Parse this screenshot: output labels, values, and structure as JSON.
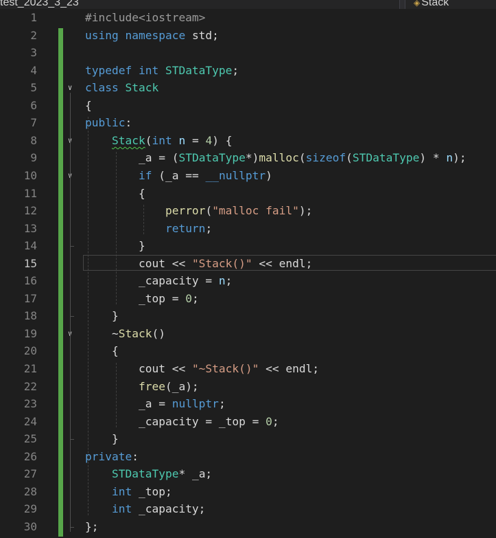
{
  "tabs": {
    "file_tab_label": "test_2023_3_23",
    "member_tab_label": "Stack"
  },
  "editor": {
    "current_line": 15,
    "line_numbers": [
      "1",
      "2",
      "3",
      "4",
      "5",
      "6",
      "7",
      "8",
      "9",
      "10",
      "11",
      "12",
      "13",
      "14",
      "15",
      "16",
      "17",
      "18",
      "19",
      "20",
      "21",
      "22",
      "23",
      "24",
      "25",
      "26",
      "27",
      "28",
      "29",
      "30"
    ],
    "lines": [
      [
        {
          "t": "#include<iostream>",
          "c": "pp"
        }
      ],
      [
        {
          "t": "using namespace ",
          "c": "kw"
        },
        {
          "t": "std;",
          "c": "pl"
        }
      ],
      [],
      [
        {
          "t": "typedef ",
          "c": "kw"
        },
        {
          "t": "int ",
          "c": "kw"
        },
        {
          "t": "STDataType",
          "c": "ty"
        },
        {
          "t": ";",
          "c": "pl"
        }
      ],
      [
        {
          "t": "class ",
          "c": "kw"
        },
        {
          "t": "Stack",
          "c": "ty"
        }
      ],
      [
        {
          "t": "{",
          "c": "pl"
        }
      ],
      [
        {
          "t": "public",
          "c": "kw"
        },
        {
          "t": ":",
          "c": "pl"
        }
      ],
      [
        {
          "t": "    "
        },
        {
          "t": "Stack",
          "c": "ty squig"
        },
        {
          "t": "(",
          "c": "pl"
        },
        {
          "t": "int ",
          "c": "kw"
        },
        {
          "t": "n",
          "c": "par"
        },
        {
          "t": " = ",
          "c": "pl"
        },
        {
          "t": "4",
          "c": "num"
        },
        {
          "t": ") {",
          "c": "pl"
        }
      ],
      [
        {
          "t": "        _a",
          "c": "mem"
        },
        {
          "t": " = (",
          "c": "pl"
        },
        {
          "t": "STDataType",
          "c": "ty"
        },
        {
          "t": "*)",
          "c": "pl"
        },
        {
          "t": "malloc",
          "c": "fn"
        },
        {
          "t": "(",
          "c": "pl"
        },
        {
          "t": "sizeof",
          "c": "kw"
        },
        {
          "t": "(",
          "c": "pl"
        },
        {
          "t": "STDataType",
          "c": "ty"
        },
        {
          "t": ") * ",
          "c": "pl"
        },
        {
          "t": "n",
          "c": "par"
        },
        {
          "t": ");",
          "c": "pl"
        }
      ],
      [
        {
          "t": "        "
        },
        {
          "t": "if ",
          "c": "kw"
        },
        {
          "t": "(_a == ",
          "c": "pl"
        },
        {
          "t": "__nullptr",
          "c": "kw"
        },
        {
          "t": ")",
          "c": "pl"
        }
      ],
      [
        {
          "t": "        {",
          "c": "pl"
        }
      ],
      [
        {
          "t": "            "
        },
        {
          "t": "perror",
          "c": "fn"
        },
        {
          "t": "(",
          "c": "pl"
        },
        {
          "t": "\"malloc fail\"",
          "c": "st"
        },
        {
          "t": ");",
          "c": "pl"
        }
      ],
      [
        {
          "t": "            "
        },
        {
          "t": "return",
          "c": "kw"
        },
        {
          "t": ";",
          "c": "pl"
        }
      ],
      [
        {
          "t": "        }",
          "c": "pl"
        }
      ],
      [
        {
          "t": "        cout << ",
          "c": "pl"
        },
        {
          "t": "\"Stack()\"",
          "c": "st"
        },
        {
          "t": " << endl;",
          "c": "pl"
        }
      ],
      [
        {
          "t": "        _capacity = ",
          "c": "pl"
        },
        {
          "t": "n",
          "c": "par"
        },
        {
          "t": ";",
          "c": "pl"
        }
      ],
      [
        {
          "t": "        _top = ",
          "c": "pl"
        },
        {
          "t": "0",
          "c": "num"
        },
        {
          "t": ";",
          "c": "pl"
        }
      ],
      [
        {
          "t": "    }",
          "c": "pl"
        }
      ],
      [
        {
          "t": "    ",
          "c": "pl"
        },
        {
          "t": "~",
          "c": "pl"
        },
        {
          "t": "Stack",
          "c": "fn"
        },
        {
          "t": "()",
          "c": "pl"
        }
      ],
      [
        {
          "t": "    {",
          "c": "pl"
        }
      ],
      [
        {
          "t": "        cout << ",
          "c": "pl"
        },
        {
          "t": "\"~Stack()\"",
          "c": "st"
        },
        {
          "t": " << endl;",
          "c": "pl"
        }
      ],
      [
        {
          "t": "        "
        },
        {
          "t": "free",
          "c": "fn"
        },
        {
          "t": "(_a);",
          "c": "pl"
        }
      ],
      [
        {
          "t": "        _a = ",
          "c": "pl"
        },
        {
          "t": "nullptr",
          "c": "kw"
        },
        {
          "t": ";",
          "c": "pl"
        }
      ],
      [
        {
          "t": "        _capacity = _top = ",
          "c": "pl"
        },
        {
          "t": "0",
          "c": "num"
        },
        {
          "t": ";",
          "c": "pl"
        }
      ],
      [
        {
          "t": "    }",
          "c": "pl"
        }
      ],
      [
        {
          "t": "private",
          "c": "kw"
        },
        {
          "t": ":",
          "c": "pl"
        }
      ],
      [
        {
          "t": "    "
        },
        {
          "t": "STDataType",
          "c": "ty"
        },
        {
          "t": "* _a;",
          "c": "pl"
        }
      ],
      [
        {
          "t": "    "
        },
        {
          "t": "int ",
          "c": "kw"
        },
        {
          "t": "_top;",
          "c": "pl"
        }
      ],
      [
        {
          "t": "    "
        },
        {
          "t": "int ",
          "c": "kw"
        },
        {
          "t": "_capacity;",
          "c": "pl"
        }
      ],
      [
        {
          "t": "};",
          "c": "pl"
        }
      ]
    ],
    "fold_markers_on_lines": [
      5,
      8,
      10,
      19
    ],
    "colors": {
      "background": "#1e1e1e",
      "keyword": "#569cd6",
      "type": "#4ec9b0",
      "function": "#dcdcaa",
      "string": "#d69d85",
      "number": "#b5cea8",
      "change_bar": "#57a64a"
    }
  }
}
